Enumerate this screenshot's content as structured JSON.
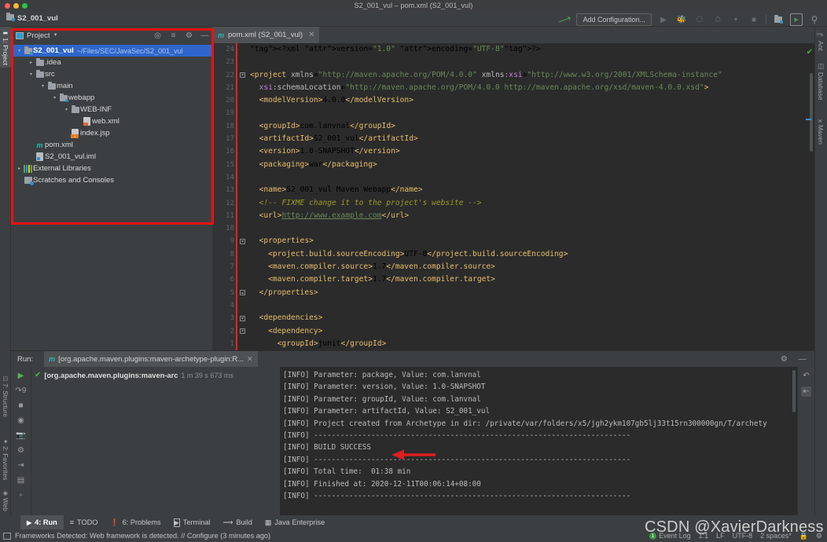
{
  "window": {
    "title": "S2_001_vul – pom.xml (S2_001_vul)",
    "project_crumb": "S2_001_vul"
  },
  "toolbar": {
    "add_configuration_label": "Add Configuration...",
    "icons": [
      "build-hammer-icon",
      "run-icon",
      "debug-icon",
      "run-with-coverage-icon",
      "profiler-icon",
      "chevron-down-icon",
      "stop-icon",
      "updating-project-icon",
      "terminal-icon",
      "search-everywhere-icon"
    ]
  },
  "left_strip": {
    "tabs": [
      {
        "label": "1: Project",
        "icon": "project-folder-icon",
        "selected": true
      },
      {
        "label": "7: Structure",
        "icon": "structure-icon",
        "selected": false
      },
      {
        "label": "2: Favorites",
        "icon": "star-icon",
        "selected": false
      },
      {
        "label": "Web",
        "icon": "web-globe-icon",
        "selected": false
      }
    ]
  },
  "right_strip": {
    "tabs": [
      {
        "label": "Ant",
        "icon": "ant-icon"
      },
      {
        "label": "Database",
        "icon": "database-icon"
      },
      {
        "label": "Maven",
        "icon": "maven-icon"
      }
    ]
  },
  "project_window": {
    "title": "Project",
    "header_icons": [
      "locate-in-tree-icon",
      "collapse-all-icon",
      "gear-icon",
      "hide-icon"
    ],
    "tree": [
      {
        "depth": 0,
        "arrow": "expanded",
        "icon": "module-folder-icon",
        "label": "S2_001_vul",
        "bold": true,
        "path": "~/Files/SEC/JavaSec/S2_001_vul",
        "selected": true
      },
      {
        "depth": 1,
        "arrow": "collapsed",
        "icon": "folder-icon",
        "label": ".idea",
        "bold": false,
        "path": "",
        "selected": false
      },
      {
        "depth": 1,
        "arrow": "expanded",
        "icon": "folder-icon",
        "label": "src",
        "bold": false,
        "path": "",
        "selected": false
      },
      {
        "depth": 2,
        "arrow": "expanded",
        "icon": "folder-icon",
        "label": "main",
        "bold": false,
        "path": "",
        "selected": false
      },
      {
        "depth": 3,
        "arrow": "expanded",
        "icon": "source-folder-icon",
        "label": "webapp",
        "bold": false,
        "path": "",
        "selected": false
      },
      {
        "depth": 4,
        "arrow": "expanded",
        "icon": "folder-icon",
        "label": "WEB-INF",
        "bold": false,
        "path": "",
        "selected": false
      },
      {
        "depth": 5,
        "arrow": "none",
        "icon": "xml-file-icon",
        "label": "web.xml",
        "bold": false,
        "path": "",
        "selected": false
      },
      {
        "depth": 4,
        "arrow": "none",
        "icon": "jsp-file-icon",
        "label": "index.jsp",
        "bold": false,
        "path": "",
        "selected": false
      },
      {
        "depth": 1,
        "arrow": "none",
        "icon": "maven-pom-icon",
        "label": "pom.xml",
        "bold": false,
        "path": "",
        "selected": false
      },
      {
        "depth": 1,
        "arrow": "none",
        "icon": "iml-file-icon",
        "label": "S2_001_vul.iml",
        "bold": false,
        "path": "",
        "selected": false
      },
      {
        "depth": 0,
        "arrow": "collapsed",
        "icon": "external-libraries-icon",
        "label": "External Libraries",
        "bold": false,
        "path": "",
        "selected": false
      },
      {
        "depth": 0,
        "arrow": "none",
        "icon": "scratches-icon",
        "label": "Scratches and Consoles",
        "bold": false,
        "path": "",
        "selected": false
      }
    ]
  },
  "editor": {
    "tab_label": "pom.xml (S2_001_vul)",
    "tab_icon": "maven-pom-icon",
    "inspection_status": "ok",
    "line_numbers": [
      1,
      2,
      3,
      4,
      5,
      6,
      7,
      8,
      9,
      10,
      11,
      12,
      13,
      14,
      15,
      16,
      17,
      18,
      19,
      20,
      21,
      22,
      23,
      24
    ],
    "lines": [
      "<?xml version=\"1.0\" encoding=\"UTF-8\"?>",
      "",
      "<project xmlns=\"http://maven.apache.org/POM/4.0.0\" xmlns:xsi=\"http://www.w3.org/2001/XMLSchema-instance\"",
      "  xsi:schemaLocation=\"http://maven.apache.org/POM/4.0.0 http://maven.apache.org/xsd/maven-4.0.0.xsd\">",
      "  <modelVersion>4.0.0</modelVersion>",
      "",
      "  <groupId>com.lanvnal</groupId>",
      "  <artifactId>S2_001_vul</artifactId>",
      "  <version>1.0-SNAPSHOT</version>",
      "  <packaging>war</packaging>",
      "",
      "  <name>S2_001_vul Maven Webapp</name>",
      "  <!-- FIXME change it to the project's website -->",
      "  <url>http://www.example.com</url>",
      "",
      "  <properties>",
      "    <project.build.sourceEncoding>UTF-8</project.build.sourceEncoding>",
      "    <maven.compiler.source>1.7</maven.compiler.source>",
      "    <maven.compiler.target>1.7</maven.compiler.target>",
      "  </properties>",
      "",
      "  <dependencies>",
      "    <dependency>",
      "      <groupId>junit</groupId>"
    ]
  },
  "run_window": {
    "label": "Run:",
    "tab_title": "[org.apache.maven.plugins:maven-archetype-plugin:R...",
    "tab_icon": "maven-pom-icon",
    "header_icons": [
      "gear-icon",
      "hide-icon"
    ],
    "gutter_icons": [
      "rerun-icon",
      "rerun-failed-icon",
      "stop-icon",
      "toggle-tasks-icon",
      "export-icon",
      "collapse-icon",
      "jump-to-source-icon",
      "print-icon",
      "expand-icon"
    ],
    "tree_node": {
      "status_icon": "check-icon",
      "label": "[org.apache.maven.plugins:maven-arc",
      "duration": "1 m 39 s 673 ms"
    },
    "right_icons": [
      "soft-wrap-icon",
      "scroll-to-end-icon"
    ],
    "console_lines": [
      "[INFO] Parameter: package, Value: com.lanvnal",
      "[INFO] Parameter: version, Value: 1.0-SNAPSHOT",
      "[INFO] Parameter: groupId, Value: com.lanvnal",
      "[INFO] Parameter: artifactId, Value: S2_001_vul",
      "[INFO] Project created from Archetype in dir: /private/var/folders/x5/jgh2ykm107gb5lj33t15rn300000gn/T/archety",
      "[INFO] ------------------------------------------------------------------------",
      "[INFO] BUILD SUCCESS",
      "[INFO] ------------------------------------------------------------------------",
      "[INFO] Total time:  01:38 min",
      "[INFO] Finished at: 2020-12-11T00:06:14+08:00",
      "[INFO] ------------------------------------------------------------------------"
    ]
  },
  "bottom_bar": {
    "items": [
      {
        "label": "4: Run",
        "mnemonic": "4",
        "icon": "run-icon",
        "selected": true
      },
      {
        "label": "TODO",
        "mnemonic": "",
        "icon": "todo-list-icon",
        "selected": false
      },
      {
        "label": "6: Problems",
        "mnemonic": "6",
        "icon": "problems-icon",
        "selected": false
      },
      {
        "label": "Terminal",
        "mnemonic": "",
        "icon": "terminal-icon",
        "selected": false
      },
      {
        "label": "Build",
        "mnemonic": "",
        "icon": "build-hammer-icon",
        "selected": false
      },
      {
        "label": "Java Enterprise",
        "mnemonic": "",
        "icon": "java-enterprise-icon",
        "selected": false
      }
    ]
  },
  "status_bar": {
    "icon": "show-hide-toolwindow-icon",
    "message": "Frameworks Detected: Web framework is detected. // Configure (3 minutes ago)",
    "event_log_label": "Event Log",
    "event_log_count": "1",
    "caret_position": "1:1",
    "line_separator": "LF",
    "encoding": "UTF-8",
    "indent": "2 spaces*",
    "right_icons": [
      "lock-icon",
      "git-branch-icon"
    ]
  },
  "watermark": "CSDN @XavierDarkness",
  "colors": {
    "accent_selection": "#2f65ca",
    "annotation_red": "#ee1111",
    "success_green": "#4bb24b",
    "editor_bg": "#2b2b2b",
    "panel_bg": "#3c3f41"
  }
}
